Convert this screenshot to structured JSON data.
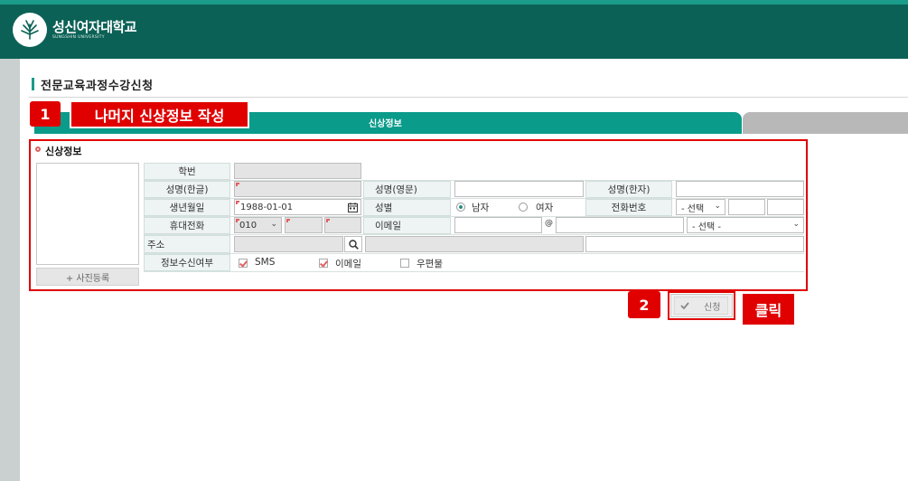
{
  "header": {
    "university_name": "성신여자대학교",
    "university_sub": "SUNGSHIN UNIVERSITY"
  },
  "page": {
    "title": "전문교육과정수강신청"
  },
  "tabs": {
    "active_label": "신상정보"
  },
  "callouts": {
    "step1_num": "1",
    "step1_text": "나머지 신상정보 작성",
    "step2_num": "2",
    "step2_text": "클릭"
  },
  "section": {
    "title": "신상정보",
    "photo_button": "+ 사진등록"
  },
  "form": {
    "labels": {
      "student_id": "학번",
      "name_korean": "성명(한글)",
      "name_english": "성명(영문)",
      "name_chinese": "성명(한자)",
      "birthdate": "생년월일",
      "gender": "성별",
      "phone": "전화번호",
      "mobile": "휴대전화",
      "email": "이메일",
      "address": "주소",
      "info_receive": "정보수신여부"
    },
    "values": {
      "birthdate": "1988-01-01",
      "mobile_prefix": "010",
      "email_at": "@",
      "phone_select": "- 선택",
      "email_domain_select": "- 선택 -"
    },
    "gender_options": {
      "male": "남자",
      "female": "여자"
    },
    "receive_options": {
      "sms": "SMS",
      "email": "이메일",
      "post": "우편물"
    }
  },
  "buttons": {
    "apply": "신청"
  }
}
